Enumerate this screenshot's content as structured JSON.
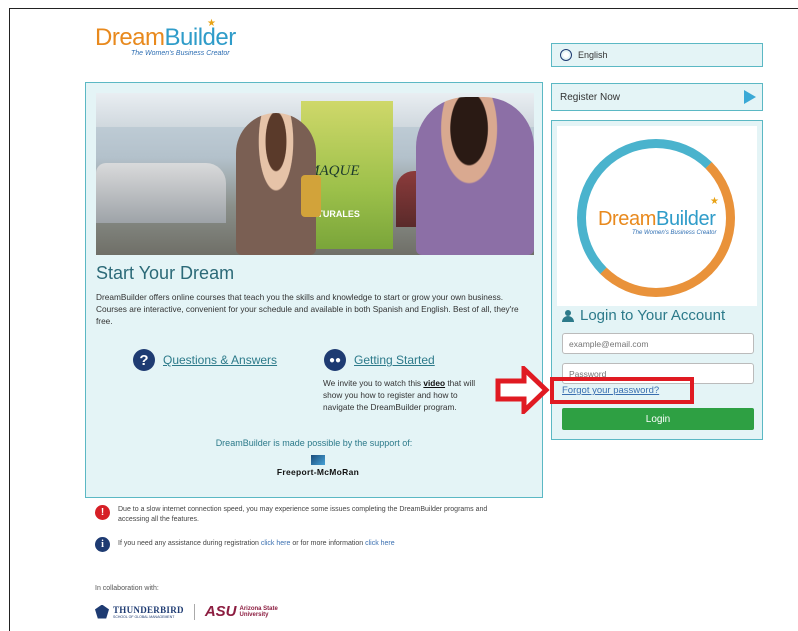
{
  "logo": {
    "part1": "Dream",
    "part2": "Builder",
    "tagline": "The Women's Business Creator"
  },
  "main": {
    "title": "Start Your Dream",
    "description": "DreamBuilder offers online courses that teach you the skills and knowledge to start or grow your own business. Courses are interactive, convenient for your schedule and available in both Spanish and English. Best of all, they're free.",
    "qa_label": "Questions & Answers",
    "getting_started_label": "Getting Started",
    "gs_text_1": "We invite you to watch this ",
    "gs_video": "video",
    "gs_text_2": " that will show you how to register and how to navigate the DreamBuilder program.",
    "support": "DreamBuilder is made possible by the support of:",
    "sponsor": "Freeport-McMoRan",
    "hero_banner_1": "MAQUE",
    "hero_banner_2": "NATURALES"
  },
  "language": {
    "label": "English"
  },
  "register": {
    "label": "Register Now"
  },
  "login": {
    "title": "Login to Your Account",
    "email_placeholder": "example@email.com",
    "password_placeholder": "Password",
    "forgot": "Forgot your password?",
    "button": "Login"
  },
  "notices": {
    "warning": "Due to a slow internet connection speed, you may experience some issues completing the DreamBuilder programs and accessing all the features.",
    "info_pre": "If you need any assistance during registration ",
    "info_link1": "click here",
    "info_mid": " or for more information ",
    "info_link2": "click here"
  },
  "footer": {
    "collab": "In collaboration with:",
    "thunderbird": "THUNDERBIRD",
    "thunderbird_sub": "SCHOOL OF GLOBAL MANAGEMENT",
    "asu": "ASU",
    "asu_sub1": "Arizona State",
    "asu_sub2": "University"
  },
  "colors": {
    "accent": "#5bb8c4",
    "login_button": "#2ea043",
    "annotation": "#e01a22"
  }
}
